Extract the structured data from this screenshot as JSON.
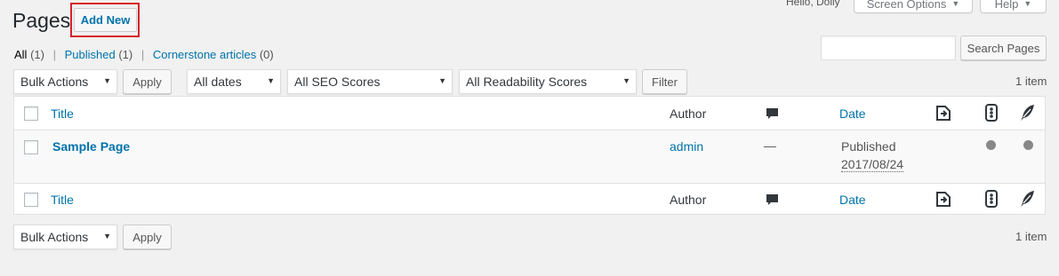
{
  "header": {
    "greeting": "Hello, Dolly",
    "screen_options": "Screen Options",
    "help": "Help",
    "title": "Pages",
    "add_new": "Add New"
  },
  "filters_nav": {
    "all": "All",
    "all_count": "(1)",
    "published": "Published",
    "published_count": "(1)",
    "cornerstone": "Cornerstone articles",
    "cornerstone_count": "(0)",
    "separator": "|"
  },
  "search": {
    "value": "",
    "button": "Search Pages"
  },
  "top_nav": {
    "bulk_actions": "Bulk Actions",
    "apply": "Apply",
    "dates": "All dates",
    "seo": "All SEO Scores",
    "readability": "All Readability Scores",
    "filter": "Filter",
    "items_count": "1 item"
  },
  "columns": {
    "title": "Title",
    "author": "Author",
    "date": "Date"
  },
  "rows": [
    {
      "title": "Sample Page",
      "author": "admin",
      "comments": "—",
      "status": "Published",
      "date": "2017/08/24"
    }
  ],
  "bottom_nav": {
    "bulk_actions": "Bulk Actions",
    "apply": "Apply",
    "items_count": "1 item"
  },
  "colors": {
    "link": "#0073aa",
    "highlight": "#d8212b",
    "background": "#f1f1f1"
  }
}
